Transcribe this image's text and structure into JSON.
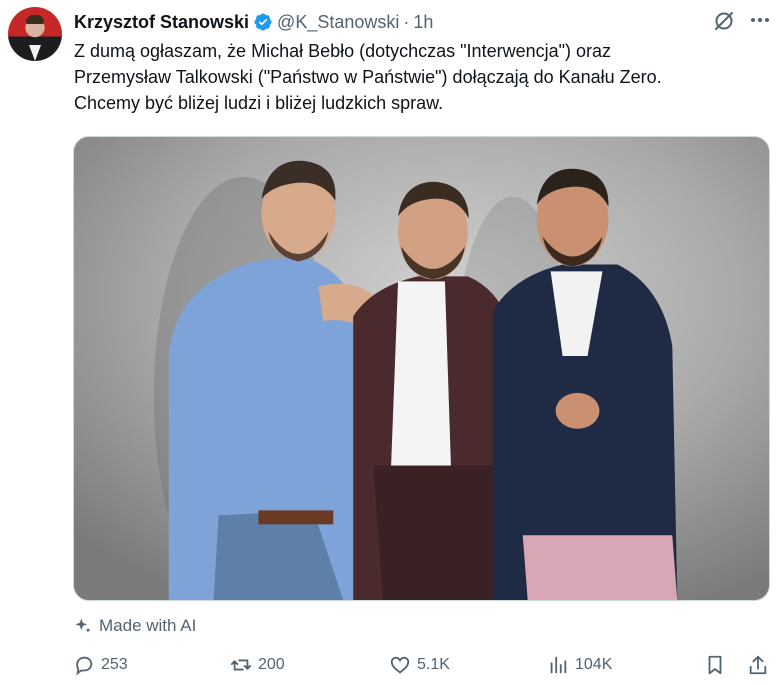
{
  "author": {
    "name": "Krzysztof Stanowski",
    "handle": "@K_Stanowski",
    "separator": "·",
    "time": "1h"
  },
  "tweet": {
    "lines": [
      "Z dumą ogłaszam, że Michał Bebło (dotychczas \"Interwencja\") oraz",
      "Przemysław Talkowski (\"Państwo w Państwie\") dołączają do Kanału Zero.",
      "Chcemy być bliżej ludzi i bliżej ludzkich spraw."
    ]
  },
  "media": {
    "label": "Made with AI"
  },
  "actions": {
    "replies": "253",
    "reposts": "200",
    "likes": "5.1K",
    "views": "104K"
  },
  "colors": {
    "verified": "#1d9bf0",
    "muted": "#536471",
    "text": "#0f1419"
  },
  "icons": [
    "grok-icon",
    "more-icon",
    "sparkle-icon",
    "reply-icon",
    "repost-icon",
    "like-icon",
    "views-icon",
    "bookmark-icon",
    "share-icon"
  ]
}
